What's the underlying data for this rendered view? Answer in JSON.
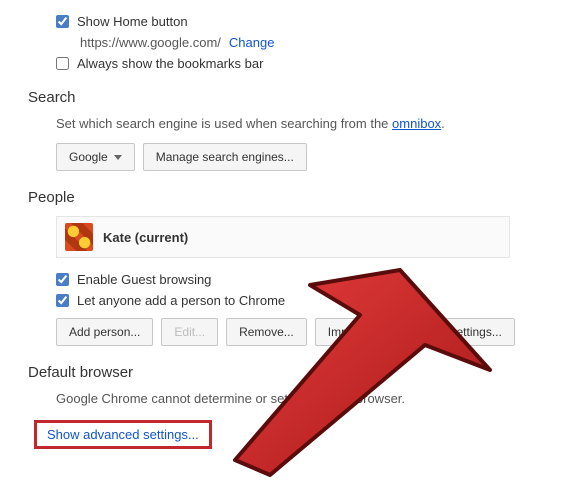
{
  "appearance": {
    "show_home_label": "Show Home button",
    "home_url": "https://www.google.com/",
    "change_link": "Change",
    "bookmarks_label": "Always show the bookmarks bar"
  },
  "search": {
    "title": "Search",
    "desc_prefix": "Set which search engine is used when searching from the ",
    "omnibox_link": "omnibox",
    "engine_button": "Google",
    "manage_button": "Manage search engines..."
  },
  "people": {
    "title": "People",
    "profile_name": "Kate (current)",
    "guest_label": "Enable Guest browsing",
    "add_anyone_label": "Let anyone add a person to Chrome",
    "add_button": "Add person...",
    "edit_button": "Edit...",
    "remove_button": "Remove...",
    "import_button": "Import bookmarks and settings..."
  },
  "default_browser": {
    "title": "Default browser",
    "desc": "Google Chrome cannot determine or set the default browser."
  },
  "advanced_link": "Show advanced settings..."
}
